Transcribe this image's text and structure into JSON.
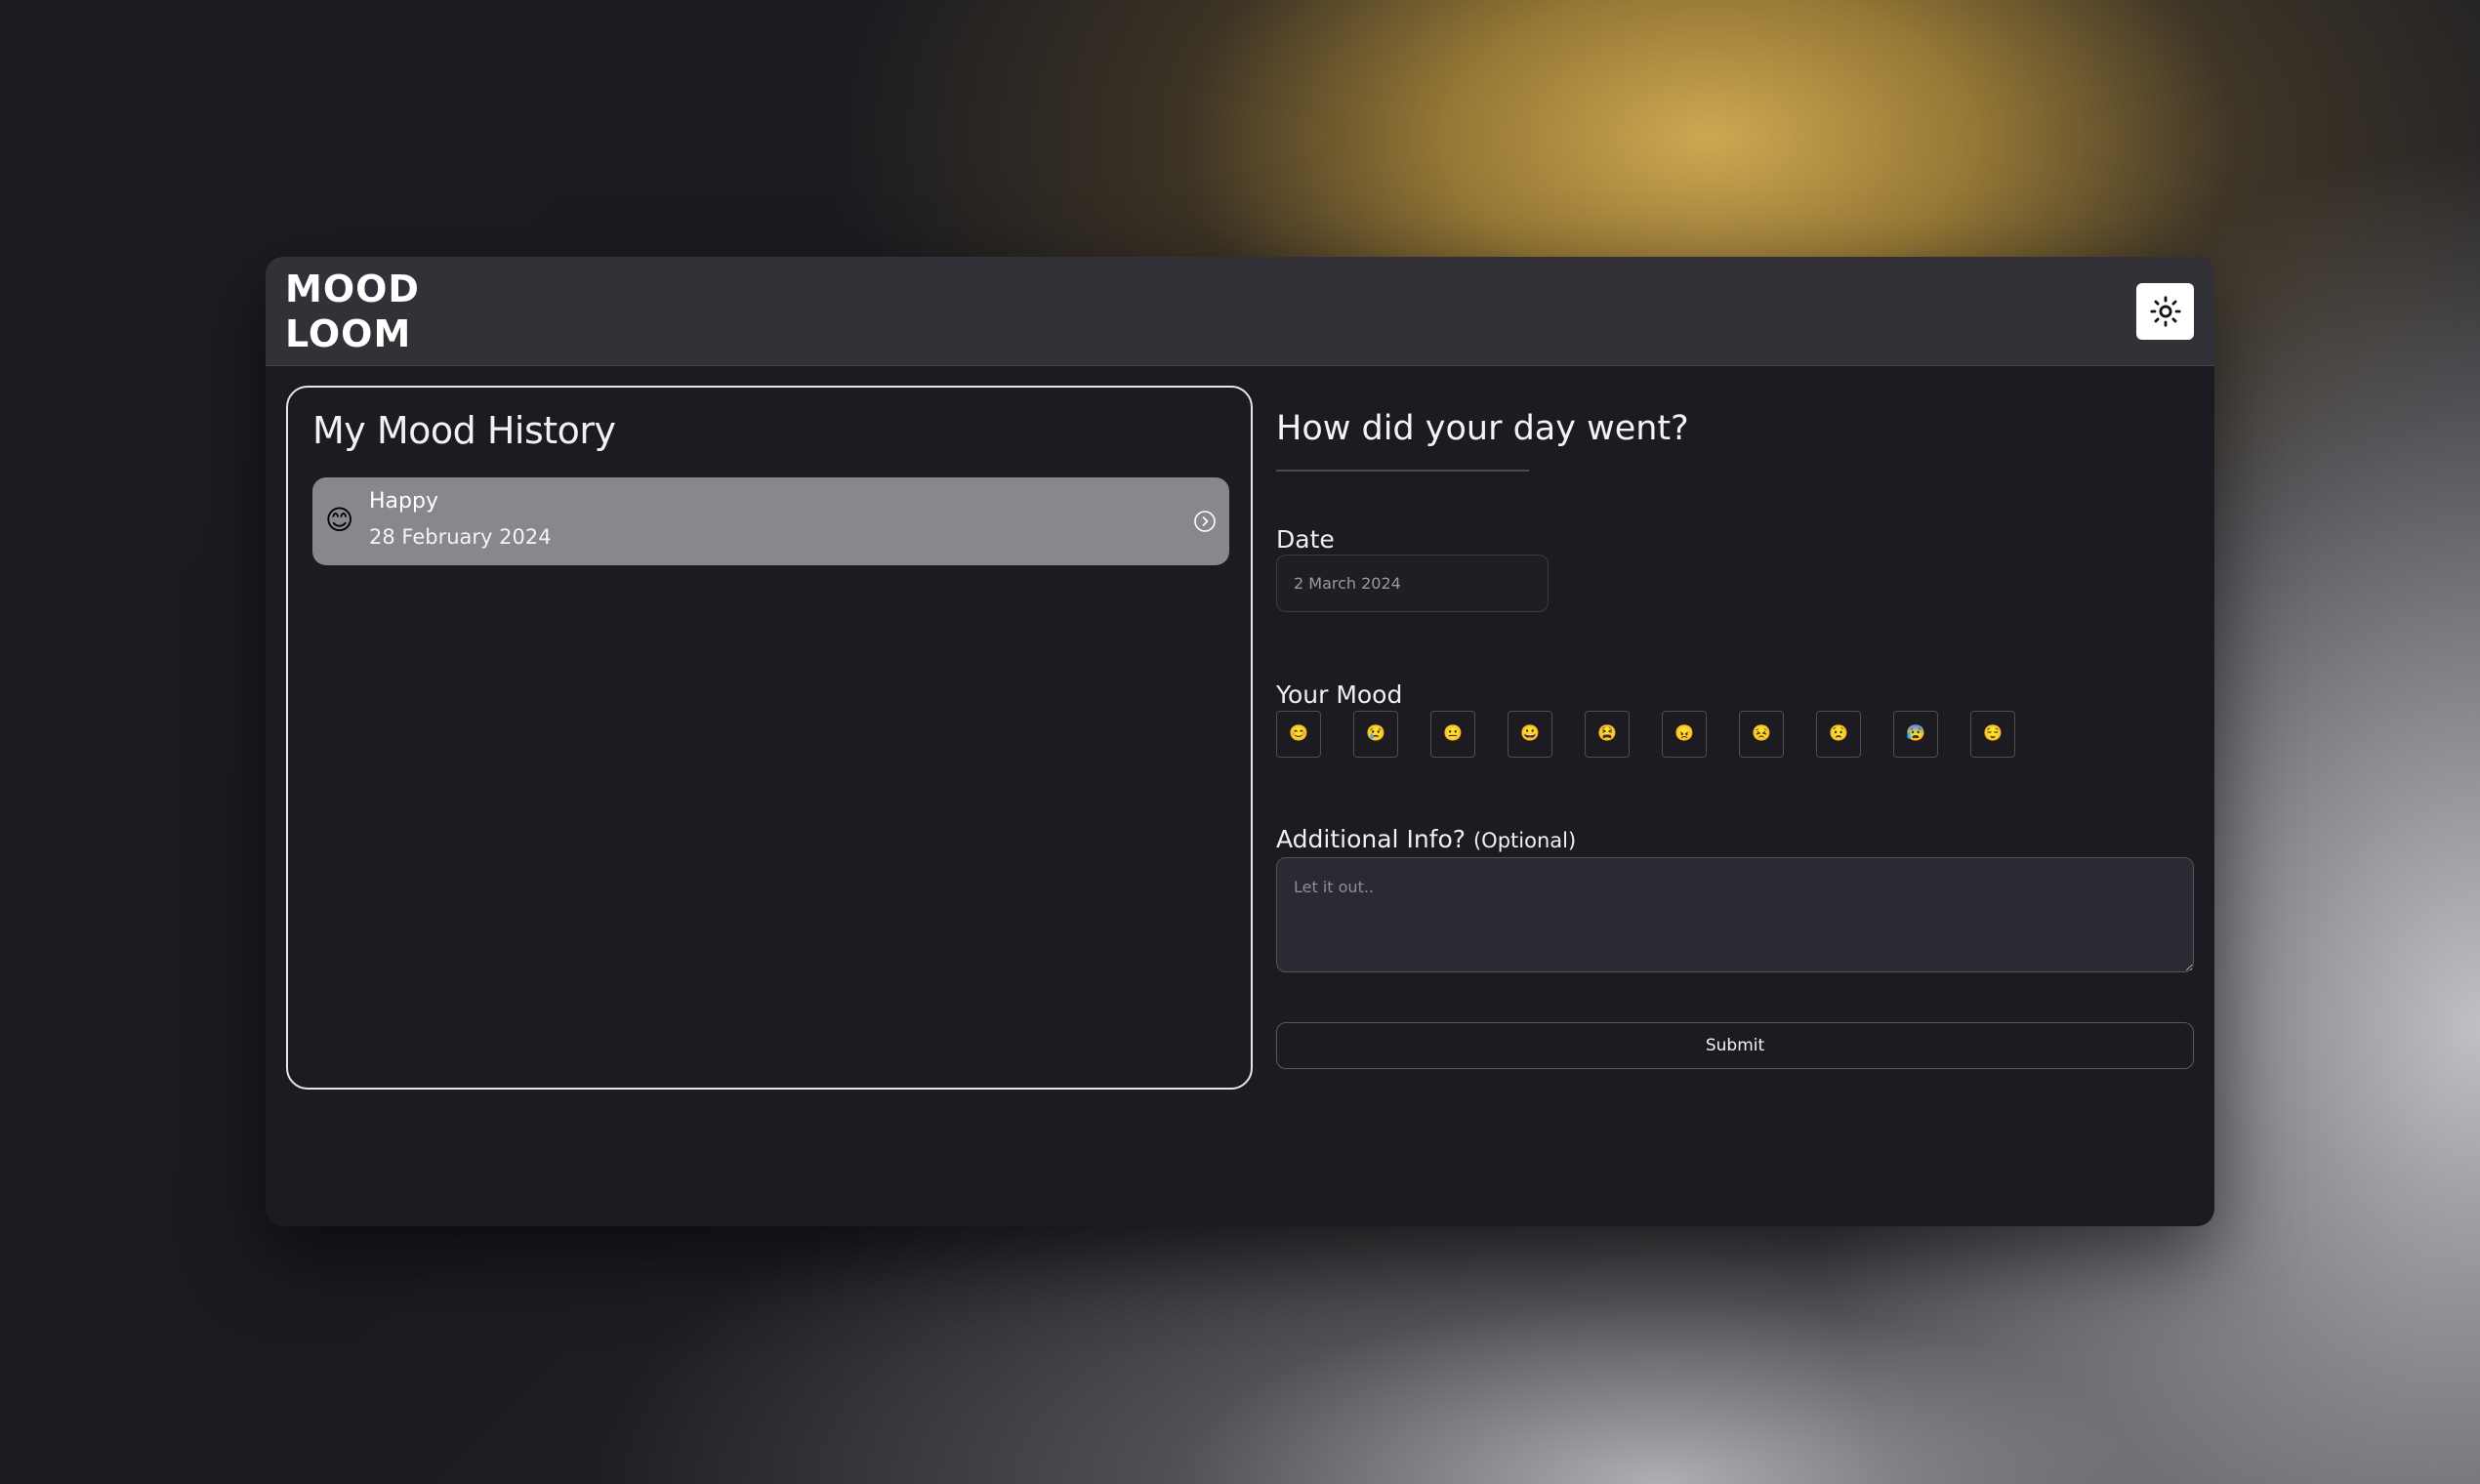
{
  "app": {
    "logo": "MOOD\nLOOM",
    "theme_toggle": {
      "icon": "sun-icon",
      "label": "Toggle theme"
    }
  },
  "history": {
    "title": "My Mood History",
    "items": [
      {
        "emoji": "😊",
        "mood": "Happy",
        "date": "28 February 2024",
        "icon": "chevron-right-circle-icon"
      }
    ]
  },
  "form": {
    "title": "How did your day went?",
    "date": {
      "label": "Date",
      "value": "2 March 2024"
    },
    "mood": {
      "label": "Your Mood",
      "options": [
        {
          "emoji": "😊",
          "name": "happy"
        },
        {
          "emoji": "😢",
          "name": "sad"
        },
        {
          "emoji": "😐",
          "name": "neutral"
        },
        {
          "emoji": "😀",
          "name": "excited"
        },
        {
          "emoji": "😫",
          "name": "tired"
        },
        {
          "emoji": "😠",
          "name": "angry"
        },
        {
          "emoji": "😣",
          "name": "stressed"
        },
        {
          "emoji": "😟",
          "name": "worried"
        },
        {
          "emoji": "😰",
          "name": "anxious"
        },
        {
          "emoji": "😌",
          "name": "calm"
        }
      ]
    },
    "additional": {
      "label": "Additional Info?",
      "optional": "(Optional)",
      "placeholder": "Let it out..",
      "value": ""
    },
    "submit_label": "Submit"
  }
}
